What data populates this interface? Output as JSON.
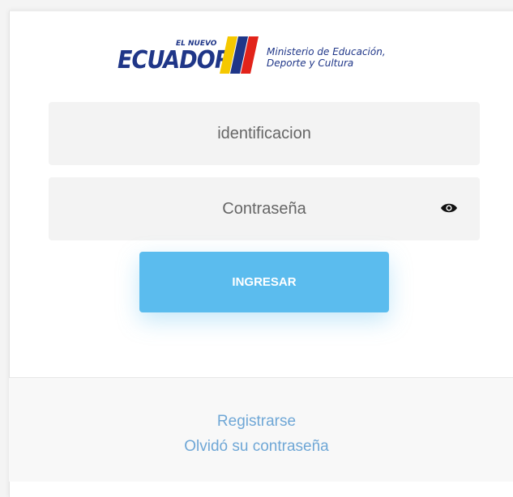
{
  "logo": {
    "nuevo": "EL NUEVO",
    "ecuador": "ECUADOR",
    "ministry": "Ministerio de Educación,\nDeporte y Cultura",
    "colors": {
      "blue": "#1f3688",
      "yellow": "#f5c800",
      "red": "#e2231a"
    }
  },
  "form": {
    "id_placeholder": "identificacion",
    "password_placeholder": "Contraseña",
    "eye_icon": "eye-icon",
    "submit_label": "INGRESAR"
  },
  "footer": {
    "register_label": "Registrarse",
    "forgot_label": "Olvidó su contraseña"
  },
  "colors": {
    "button": "#5bbcee",
    "link": "#6fa7d6"
  }
}
